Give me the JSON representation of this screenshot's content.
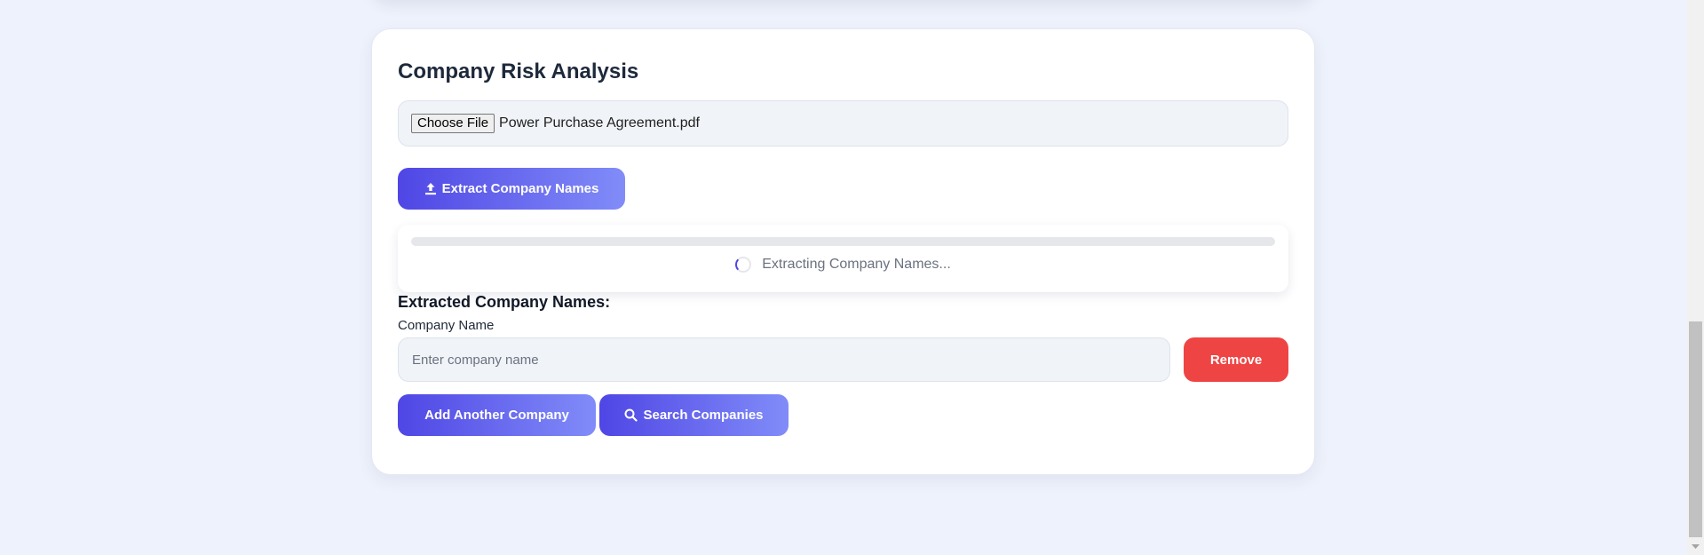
{
  "card": {
    "title": "Company Risk Analysis"
  },
  "file_upload": {
    "button_label": "Choose File",
    "file_name": "Power Purchase Agreement.pdf"
  },
  "extract_button": {
    "label": "Extract Company Names",
    "icon": "upload-icon"
  },
  "progress": {
    "value": 0,
    "status_text": "Extracting Company Names...",
    "spinner_icon": "spinner-icon"
  },
  "companies": {
    "section_title": "Extracted Company Names:",
    "field_label": "Company Name",
    "input_value": "",
    "input_placeholder": "Enter company name",
    "remove_label": "Remove"
  },
  "actions": {
    "add_label": "Add Another Company",
    "search_label": "Search Companies",
    "search_icon": "search-icon"
  },
  "colors": {
    "accent_start": "#4f46e5",
    "accent_end": "#818cf8",
    "danger": "#ef4444",
    "background": "#eef2fc"
  }
}
